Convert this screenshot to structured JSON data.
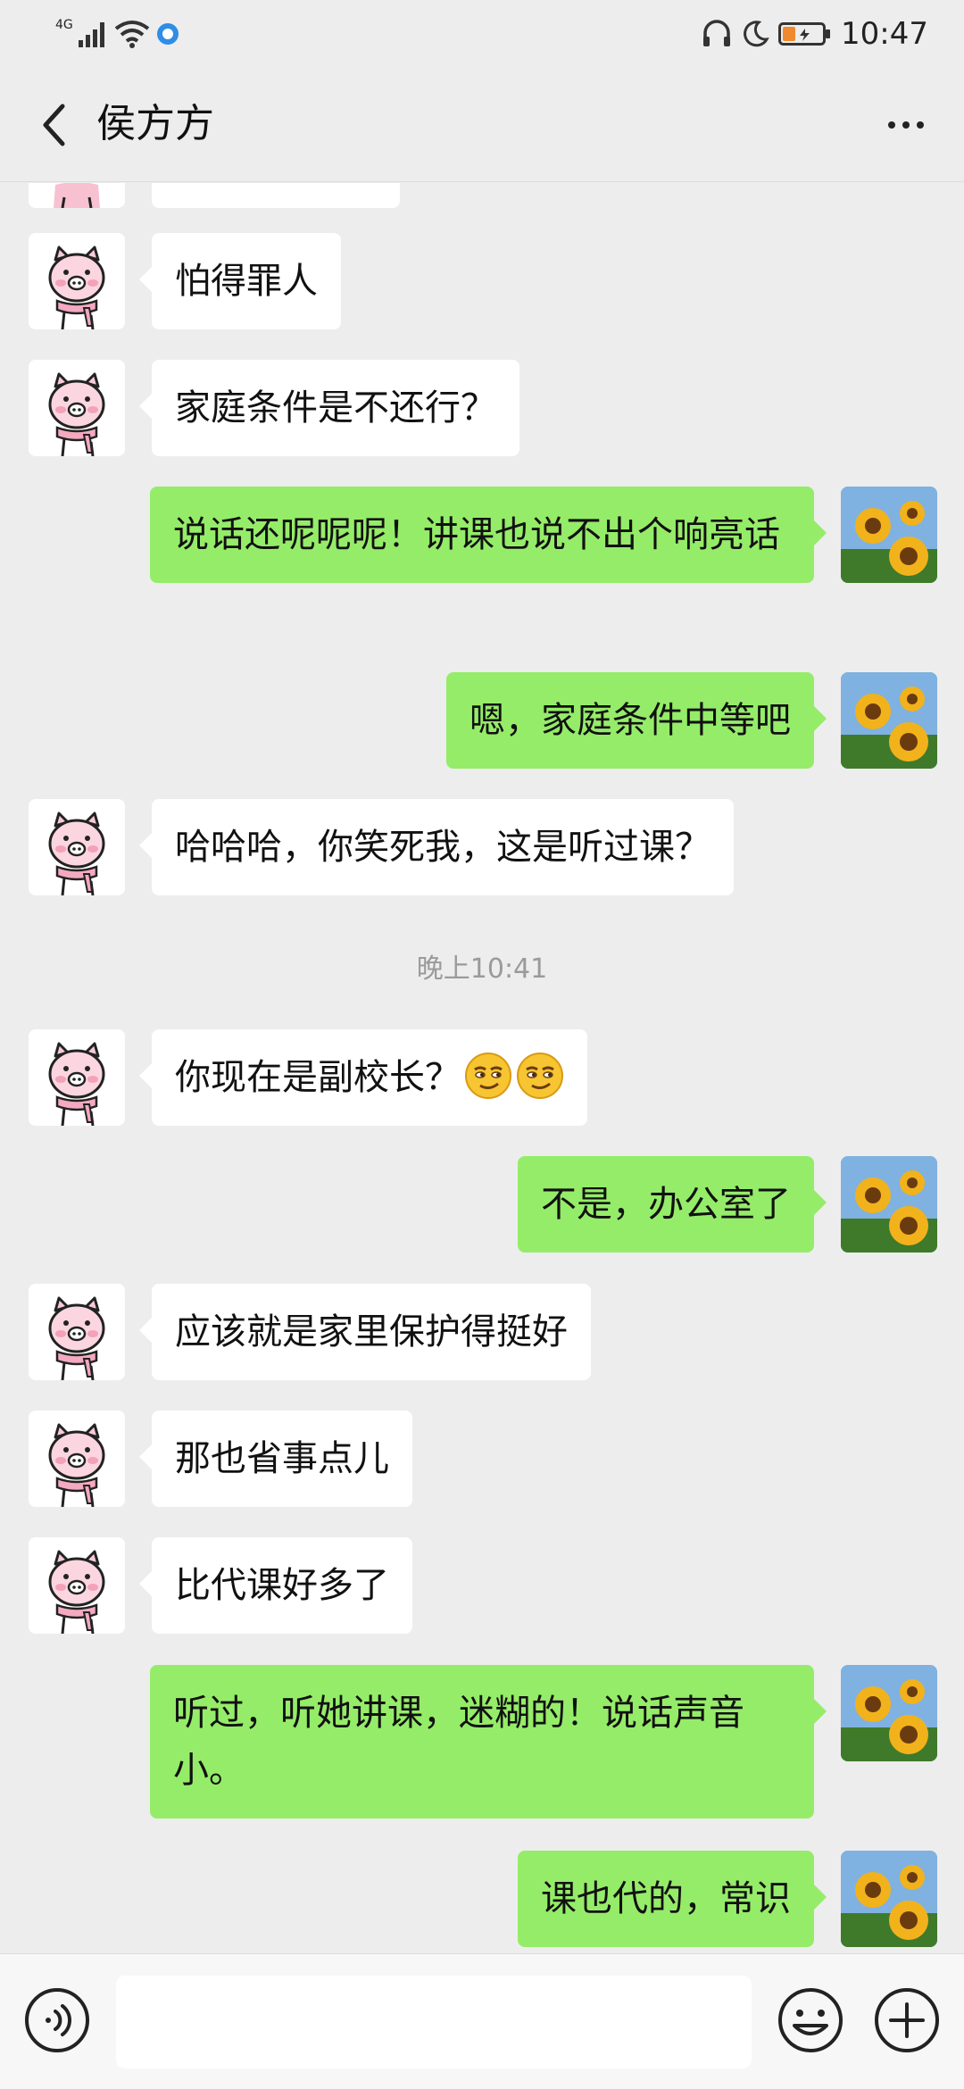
{
  "status_bar": {
    "network_type": "4G",
    "time": "10:47"
  },
  "header": {
    "title": "侯方方"
  },
  "messages": [
    {
      "side": "left",
      "text": ""
    },
    {
      "side": "left",
      "text": "怕得罪人"
    },
    {
      "side": "left",
      "text": "家庭条件是不还行？"
    },
    {
      "side": "right",
      "text": "说话还呢呢呢！讲课也说不出个响亮话"
    },
    {
      "side": "right",
      "text": "嗯，家庭条件中等吧"
    },
    {
      "side": "left",
      "text": "哈哈哈，你笑死我，这是听过课？"
    },
    {
      "side": "left",
      "text": "你现在是副校长？"
    },
    {
      "side": "right",
      "text": "不是，办公室了"
    },
    {
      "side": "left",
      "text": "应该就是家里保护得挺好"
    },
    {
      "side": "left",
      "text": "那也省事点儿"
    },
    {
      "side": "left",
      "text": "比代课好多了"
    },
    {
      "side": "right",
      "text": "听过，听她讲课，迷糊的！说话声音小。"
    },
    {
      "side": "right",
      "text": "课也代的，常识"
    }
  ],
  "timestamp": "晚上10:41",
  "input": {
    "value": "",
    "placeholder": ""
  },
  "colors": {
    "background": "#ededed",
    "sent_bubble": "#95ec69",
    "received_bubble": "#ffffff",
    "timestamp": "#9a9a9a"
  },
  "icons": {
    "back": "back-chevron-icon",
    "more": "more-dots-icon",
    "voice": "voice-icon",
    "emoji": "emoji-icon",
    "plus": "plus-icon"
  }
}
